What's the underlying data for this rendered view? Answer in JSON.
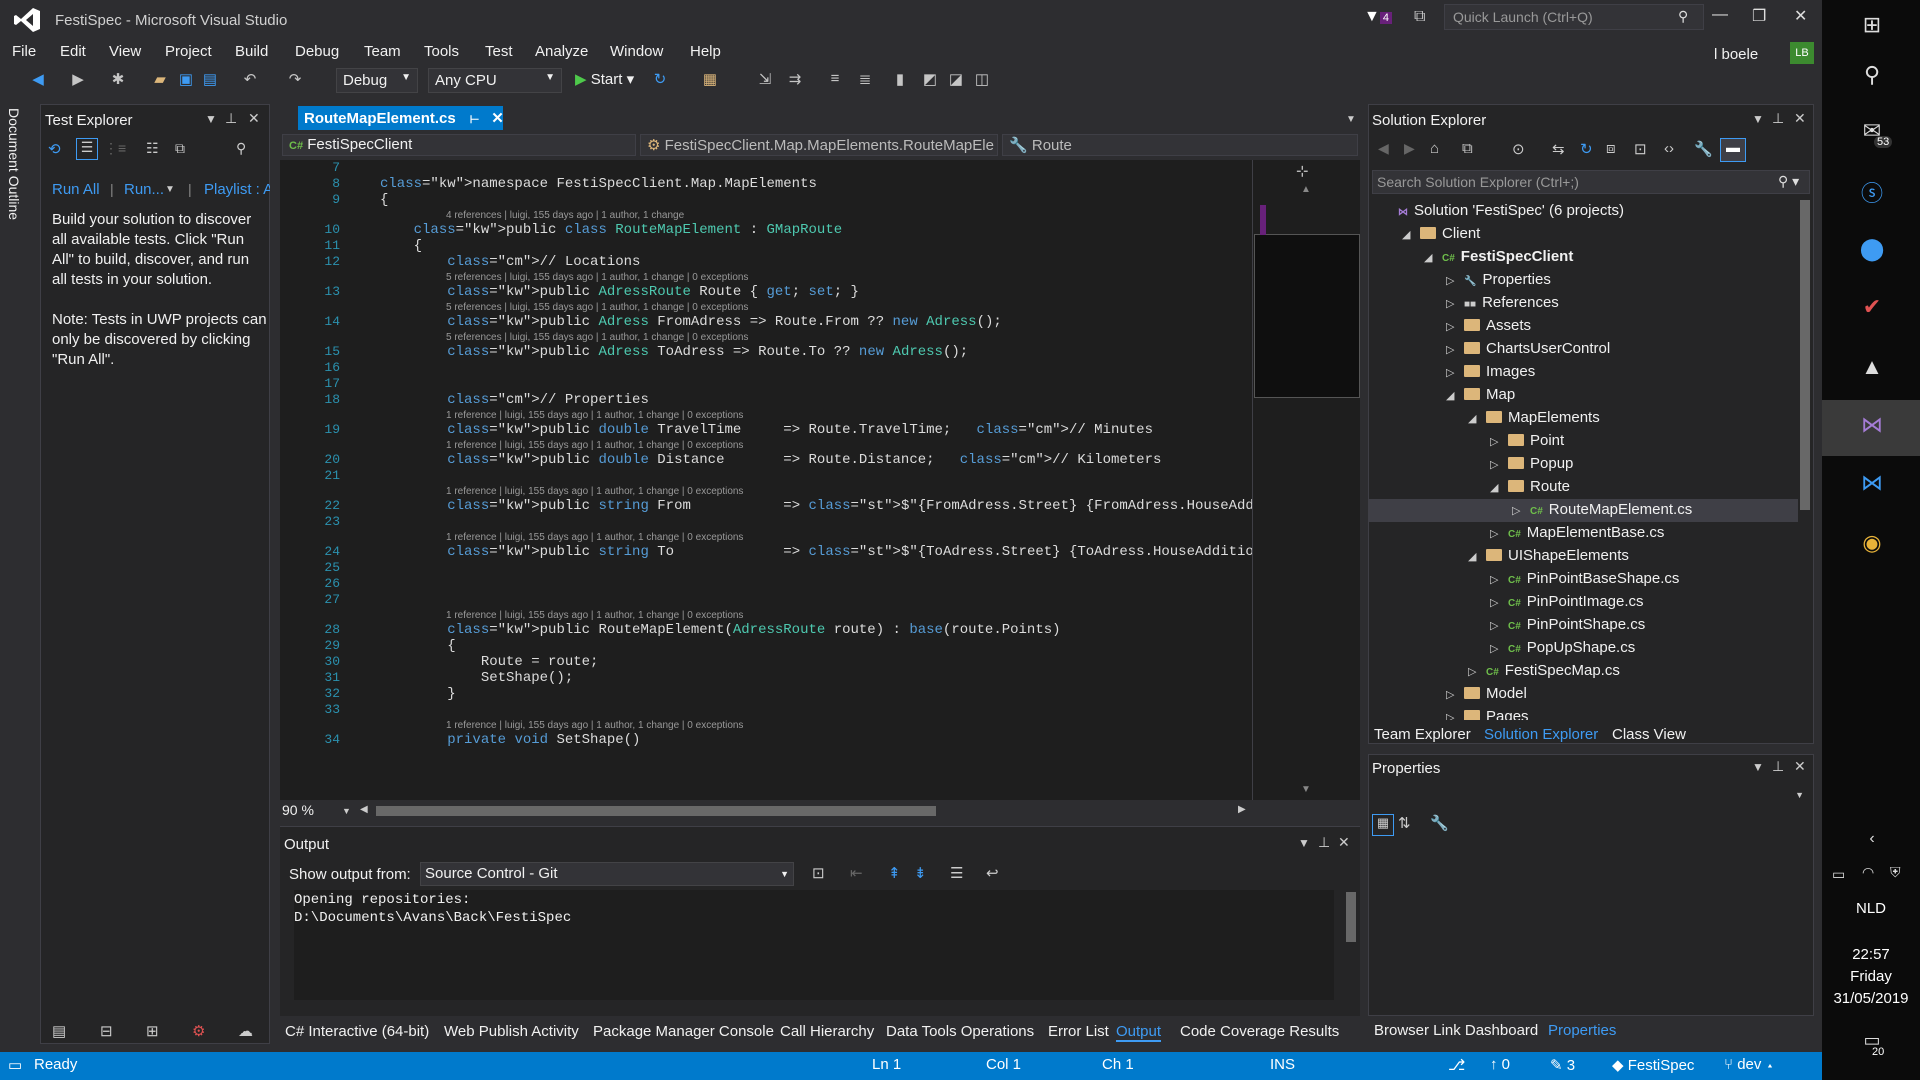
{
  "window": {
    "title": "FestiSpec - Microsoft Visual Studio",
    "quick_launch": "Quick Launch (Ctrl+Q)",
    "notifications": "4",
    "user": "l boele",
    "user_initials": "LB"
  },
  "menu": [
    "File",
    "Edit",
    "View",
    "Project",
    "Build",
    "Debug",
    "Team",
    "Tools",
    "Test",
    "Analyze",
    "Window",
    "Help"
  ],
  "toolbar": {
    "config": "Debug",
    "platform": "Any CPU",
    "start": "Start"
  },
  "doc_outline": "Document Outline",
  "test_explorer": {
    "title": "Test Explorer",
    "run_all": "Run All",
    "run": "Run...",
    "playlist": "Playlist : A",
    "message1": "Build your solution to discover all available tests. Click \"Run All\" to build, discover, and run all tests in your solution.",
    "message2": "Note: Tests in UWP projects can only be discovered by clicking \"Run All\"."
  },
  "editor": {
    "tab": "RouteMapElement.cs",
    "nav_project": "FestiSpecClient",
    "nav_class": "FestiSpecClient.Map.MapElements.RouteMapEle",
    "nav_member": "Route",
    "zoom": "90 %",
    "lines": [
      {
        "n": "7",
        "code": ""
      },
      {
        "n": "8",
        "code": "namespace FestiSpecClient.Map.MapElements"
      },
      {
        "n": "9",
        "code": "{"
      },
      {
        "n": "",
        "lens": "4 references | luigi, 155 days ago | 1 author, 1 change"
      },
      {
        "n": "10",
        "code": "    public class RouteMapElement : GMapRoute"
      },
      {
        "n": "11",
        "code": "    {"
      },
      {
        "n": "12",
        "code": "        // Locations"
      },
      {
        "n": "",
        "lens": "5 references | luigi, 155 days ago | 1 author, 1 change | 0 exceptions"
      },
      {
        "n": "13",
        "code": "        public AdressRoute Route { get; set; }"
      },
      {
        "n": "",
        "lens": "5 references | luigi, 155 days ago | 1 author, 1 change | 0 exceptions"
      },
      {
        "n": "14",
        "code": "        public Adress FromAdress => Route.From ?? new Adress();"
      },
      {
        "n": "",
        "lens": "5 references | luigi, 155 days ago | 1 author, 1 change | 0 exceptions"
      },
      {
        "n": "15",
        "code": "        public Adress ToAdress => Route.To ?? new Adress();"
      },
      {
        "n": "16",
        "code": ""
      },
      {
        "n": "17",
        "code": ""
      },
      {
        "n": "18",
        "code": "        // Properties"
      },
      {
        "n": "",
        "lens": "1 reference | luigi, 155 days ago | 1 author, 1 change | 0 exceptions"
      },
      {
        "n": "19",
        "code": "        public double TravelTime     => Route.TravelTime;   // Minutes"
      },
      {
        "n": "",
        "lens": "1 reference | luigi, 155 days ago | 1 author, 1 change | 0 exceptions"
      },
      {
        "n": "20",
        "code": "        public double Distance       => Route.Distance;   // Kilometers"
      },
      {
        "n": "21",
        "code": ""
      },
      {
        "n": "",
        "lens": "1 reference | luigi, 155 days ago | 1 author, 1 change | 0 exceptions"
      },
      {
        "n": "22",
        "code": "        public string From           => $\"{FromAdress.Street} {FromAdress.HouseAddition} {FromAdress.HouseNuml"
      },
      {
        "n": "23",
        "code": ""
      },
      {
        "n": "",
        "lens": "1 reference | luigi, 155 days ago | 1 author, 1 change | 0 exceptions"
      },
      {
        "n": "24",
        "code": "        public string To             => $\"{ToAdress.Street} {ToAdress.HouseAddition} {ToAdress.HouseNumber}, -"
      },
      {
        "n": "25",
        "code": ""
      },
      {
        "n": "26",
        "code": ""
      },
      {
        "n": "27",
        "code": ""
      },
      {
        "n": "",
        "lens": "1 reference | luigi, 155 days ago | 1 author, 1 change | 0 exceptions"
      },
      {
        "n": "28",
        "code": "        public RouteMapElement(AdressRoute route) : base(route.Points)"
      },
      {
        "n": "29",
        "code": "        {"
      },
      {
        "n": "30",
        "code": "            Route = route;"
      },
      {
        "n": "31",
        "code": "            SetShape();"
      },
      {
        "n": "32",
        "code": "        }"
      },
      {
        "n": "33",
        "code": ""
      },
      {
        "n": "",
        "lens": "1 reference | luigi, 155 days ago | 1 author, 1 change | 0 exceptions"
      },
      {
        "n": "34",
        "code": "        private void SetShape()"
      }
    ]
  },
  "output": {
    "title": "Output",
    "show_from_label": "Show output from:",
    "source": "Source Control - Git",
    "text1": "Opening repositories:",
    "text2": "D:\\Documents\\Avans\\Back\\FestiSpec"
  },
  "bottom_tabs": [
    "C# Interactive (64-bit)",
    "Web Publish Activity",
    "Package Manager Console",
    "Call Hierarchy",
    "Data Tools Operations",
    "Error List",
    "Output",
    "Code Coverage Results"
  ],
  "solution_explorer": {
    "title": "Solution Explorer",
    "search": "Search Solution Explorer (Ctrl+;)",
    "items": [
      {
        "label": "Solution 'FestiSpec' (6 projects)",
        "depth": 0,
        "kind": "solution"
      },
      {
        "label": "Client",
        "depth": 1,
        "kind": "folder",
        "open": true
      },
      {
        "label": "FestiSpecClient",
        "depth": 2,
        "kind": "project",
        "open": true
      },
      {
        "label": "Properties",
        "depth": 3,
        "kind": "props"
      },
      {
        "label": "References",
        "depth": 3,
        "kind": "refs"
      },
      {
        "label": "Assets",
        "depth": 3,
        "kind": "folder"
      },
      {
        "label": "ChartsUserControl",
        "depth": 3,
        "kind": "folder"
      },
      {
        "label": "Images",
        "depth": 3,
        "kind": "folder"
      },
      {
        "label": "Map",
        "depth": 3,
        "kind": "folder",
        "open": true
      },
      {
        "label": "MapElements",
        "depth": 4,
        "kind": "folder",
        "open": true
      },
      {
        "label": "Point",
        "depth": 5,
        "kind": "folder"
      },
      {
        "label": "Popup",
        "depth": 5,
        "kind": "folder"
      },
      {
        "label": "Route",
        "depth": 5,
        "kind": "folder",
        "open": true
      },
      {
        "label": "RouteMapElement.cs",
        "depth": 6,
        "kind": "cs",
        "selected": true
      },
      {
        "label": "MapElementBase.cs",
        "depth": 5,
        "kind": "cs"
      },
      {
        "label": "UIShapeElements",
        "depth": 4,
        "kind": "folder",
        "open": true
      },
      {
        "label": "PinPointBaseShape.cs",
        "depth": 5,
        "kind": "cs"
      },
      {
        "label": "PinPointImage.cs",
        "depth": 5,
        "kind": "cs"
      },
      {
        "label": "PinPointShape.cs",
        "depth": 5,
        "kind": "cs"
      },
      {
        "label": "PopUpShape.cs",
        "depth": 5,
        "kind": "cs"
      },
      {
        "label": "FestiSpecMap.cs",
        "depth": 4,
        "kind": "cs"
      },
      {
        "label": "Model",
        "depth": 3,
        "kind": "folder"
      },
      {
        "label": "Pages",
        "depth": 3,
        "kind": "folder"
      }
    ],
    "tabs": [
      "Team Explorer",
      "Solution Explorer",
      "Class View"
    ]
  },
  "properties": {
    "title": "Properties",
    "tabs": [
      "Browser Link Dashboard",
      "Properties"
    ]
  },
  "status": {
    "ready": "Ready",
    "ln": "Ln 1",
    "col": "Col 1",
    "ch": "Ch 1",
    "ins": "INS",
    "up": "0",
    "pencil": "3",
    "repo": "FestiSpec",
    "branch": "dev"
  },
  "taskbar": {
    "mail_count": "53",
    "lang": "NLD",
    "time": "22:57",
    "day": "Friday",
    "date": "31/05/2019",
    "notif": "20"
  },
  "colors": {
    "accent": "#007acc",
    "bg": "#2d2d30",
    "editor_bg": "#1e1e1e",
    "link": "#3e9bf3"
  }
}
